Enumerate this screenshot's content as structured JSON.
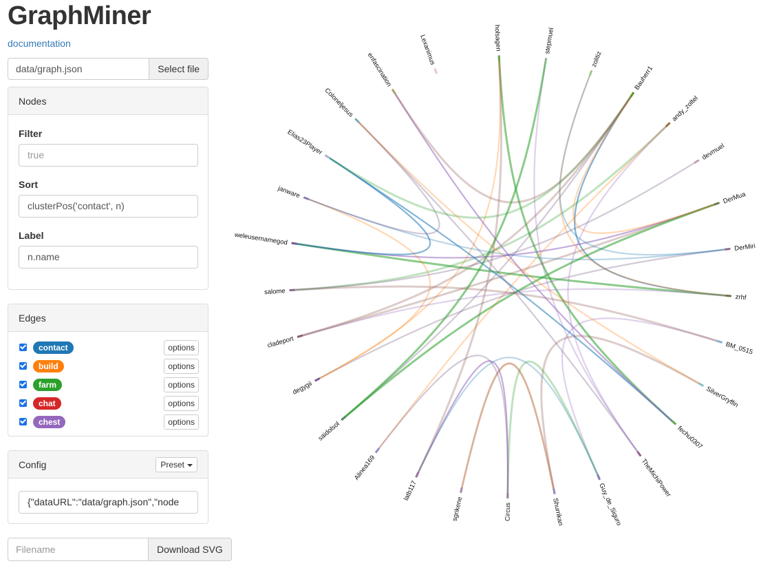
{
  "app": {
    "title": "GraphMiner",
    "doc_link": "documentation"
  },
  "file": {
    "path": "data/graph.json",
    "select_label": "Select file"
  },
  "nodes_panel": {
    "heading": "Nodes",
    "filter_label": "Filter",
    "filter_placeholder": "true",
    "sort_label": "Sort",
    "sort_value": "clusterPos('contact',  n)",
    "label_label": "Label",
    "label_value": "n.name"
  },
  "edges_panel": {
    "heading": "Edges",
    "options_label": "options",
    "types": [
      {
        "name": "contact",
        "color": "#1f77b4",
        "checked": true
      },
      {
        "name": "build",
        "color": "#ff7f0e",
        "checked": true
      },
      {
        "name": "farm",
        "color": "#2ca02c",
        "checked": true
      },
      {
        "name": "chat",
        "color": "#d62728",
        "checked": true
      },
      {
        "name": "chest",
        "color": "#9467bd",
        "checked": true
      }
    ]
  },
  "config_panel": {
    "heading": "Config",
    "preset_label": "Preset",
    "config_value": "{\"dataURL\":\"data/graph.json\",\"node"
  },
  "export": {
    "filename_placeholder": "Filename",
    "download_label": "Download SVG"
  },
  "graph": {
    "nodes": [
      {
        "name": "holsagen",
        "color": "#6aa84f"
      },
      {
        "name": "stepmuel",
        "color": "#8fbc8f"
      },
      {
        "name": "zolitiz",
        "color": "#a3c585"
      },
      {
        "name": "Bauherr1",
        "color": "#6b8e23"
      },
      {
        "name": "andy_zoltel",
        "color": "#a0703c"
      },
      {
        "name": "devmuel",
        "color": "#c8a0b0"
      },
      {
        "name": "DerMua",
        "color": "#6d7a5a"
      },
      {
        "name": "DerMiri",
        "color": "#8e6a8a"
      },
      {
        "name": "zrhf",
        "color": "#7a6a4a"
      },
      {
        "name": "BM_0515",
        "color": "#8fb0d0"
      },
      {
        "name": "SilverGryffin",
        "color": "#8ec0c0"
      },
      {
        "name": "fechu0307",
        "color": "#6aa84f"
      },
      {
        "name": "TheMichiPower",
        "color": "#9a6090"
      },
      {
        "name": "Guy_de_Siguro",
        "color": "#8a7ab0"
      },
      {
        "name": "Shurrikan",
        "color": "#9a8ac0"
      },
      {
        "name": "Circus",
        "color": "#9a7aa0"
      },
      {
        "name": "sgrikene",
        "color": "#a58ab0"
      },
      {
        "name": "latb117",
        "color": "#9a70a0"
      },
      {
        "name": "Alinea169",
        "color": "#9a8ac0"
      },
      {
        "name": "saidolsol",
        "color": "#5a8a6a"
      },
      {
        "name": "degygii",
        "color": "#7a5a9a"
      },
      {
        "name": "cladeport",
        "color": "#8a5a7a"
      },
      {
        "name": "salome",
        "color": "#8a6a9a"
      },
      {
        "name": "weleusernamegod",
        "color": "#7a5a9a"
      },
      {
        "name": "janware",
        "color": "#8a7ab0"
      },
      {
        "name": "Elias23Player",
        "color": "#b0b0d8"
      },
      {
        "name": "Coloneljesus",
        "color": "#7aaab0"
      },
      {
        "name": "enfascination",
        "color": "#b0a070"
      },
      {
        "name": "Lexanimus",
        "color": "#e8c8c8"
      }
    ]
  }
}
